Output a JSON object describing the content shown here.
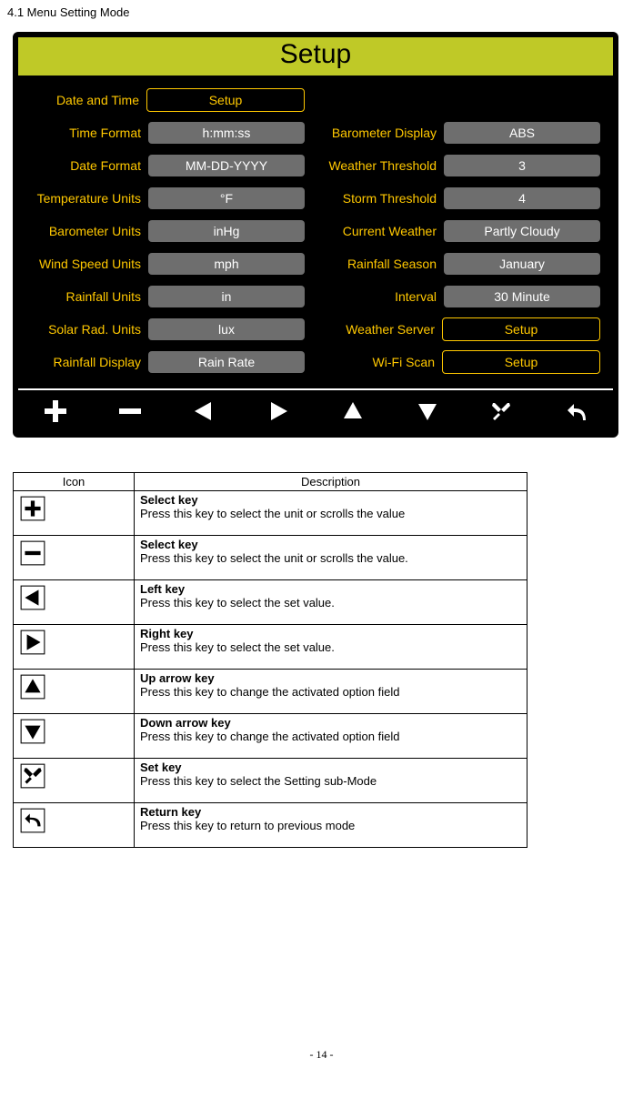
{
  "section_title": "4.1 Menu Setting Mode",
  "setup_title": "Setup",
  "left_settings": [
    {
      "label": "Date and Time",
      "value": "Setup",
      "special": true
    },
    {
      "label": "Time Format",
      "value": "h:mm:ss"
    },
    {
      "label": "Date Format",
      "value": "MM-DD-YYYY"
    },
    {
      "label": "Temperature Units",
      "value": "°F"
    },
    {
      "label": "Barometer Units",
      "value": "inHg"
    },
    {
      "label": "Wind Speed Units",
      "value": "mph"
    },
    {
      "label": "Rainfall Units",
      "value": "in"
    },
    {
      "label": "Solar Rad. Units",
      "value": "lux"
    },
    {
      "label": "Rainfall Display",
      "value": "Rain Rate"
    }
  ],
  "right_settings": [
    {
      "label": "",
      "value": "",
      "empty": true
    },
    {
      "label": "Barometer Display",
      "value": "ABS"
    },
    {
      "label": "Weather Threshold",
      "value": "3"
    },
    {
      "label": "Storm Threshold",
      "value": "4"
    },
    {
      "label": "Current Weather",
      "value": "Partly Cloudy"
    },
    {
      "label": "Rainfall Season",
      "value": "January"
    },
    {
      "label": "Interval",
      "value": "30 Minute"
    },
    {
      "label": "Weather Server",
      "value": "Setup",
      "special": true
    },
    {
      "label": "Wi-Fi Scan",
      "value": "Setup",
      "special": true
    }
  ],
  "table_headers": {
    "icon": "Icon",
    "desc": "Description"
  },
  "table_rows": [
    {
      "icon": "plus",
      "title": "Select key",
      "body": "Press this key to select the unit or scrolls the value"
    },
    {
      "icon": "minus",
      "title": "Select key",
      "body": "Press this key to select the unit or scrolls the value."
    },
    {
      "icon": "left",
      "title": "Left key",
      "body": "Press this key to select the set value."
    },
    {
      "icon": "right",
      "title": "Right key",
      "body": "Press this key to select the set value."
    },
    {
      "icon": "up",
      "title": "Up arrow key",
      "body": "Press this key to change the activated option field"
    },
    {
      "icon": "down",
      "title": "Down arrow key",
      "body": "Press this key to change the activated option field"
    },
    {
      "icon": "wrench",
      "title": "Set key",
      "body": "Press this key to select the Setting sub-Mode"
    },
    {
      "icon": "return",
      "title": "Return key",
      "body_pre": "Press this key to return to ",
      "body_word": "previous",
      "body_post": " mode"
    }
  ],
  "page_number": "- 14 -"
}
